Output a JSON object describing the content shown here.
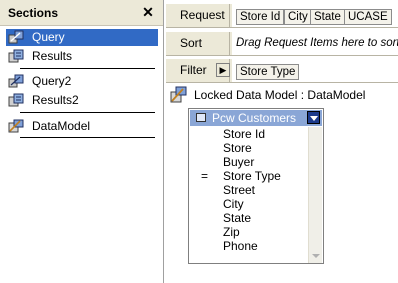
{
  "sections": {
    "title": "Sections",
    "close_glyph": "✕",
    "items": [
      {
        "label": "Query",
        "icon": "query-icon",
        "selected": true
      },
      {
        "label": "Results",
        "icon": "results-icon",
        "selected": false
      },
      {
        "label": "Query2",
        "icon": "query-icon",
        "selected": false
      },
      {
        "label": "Results2",
        "icon": "results-icon",
        "selected": false
      },
      {
        "label": "DataModel",
        "icon": "datamodel-icon",
        "selected": false
      }
    ]
  },
  "request_panel": {
    "request": {
      "label": "Request",
      "chips": [
        "Store Id",
        "City",
        "State",
        "UCASE"
      ]
    },
    "sort": {
      "label": "Sort",
      "hint": "Drag Request Items here to sort t"
    },
    "filter": {
      "label": "Filter",
      "arrow_glyph": "▶",
      "chips": [
        "Store Type"
      ]
    }
  },
  "data_model": {
    "title": "Locked Data Model : DataModel",
    "table": {
      "name": "Pcw Customers",
      "fields": [
        {
          "name": "Store Id",
          "mark": ""
        },
        {
          "name": "Store",
          "mark": ""
        },
        {
          "name": "Buyer",
          "mark": ""
        },
        {
          "name": "Store Type",
          "mark": "="
        },
        {
          "name": "Street",
          "mark": ""
        },
        {
          "name": "City",
          "mark": ""
        },
        {
          "name": "State",
          "mark": ""
        },
        {
          "name": "Zip",
          "mark": ""
        },
        {
          "name": "Phone",
          "mark": ""
        }
      ]
    }
  },
  "colors": {
    "selection": "#316ac5",
    "panel_bg": "#ece9d8",
    "table_header": "#8aa6d6"
  }
}
